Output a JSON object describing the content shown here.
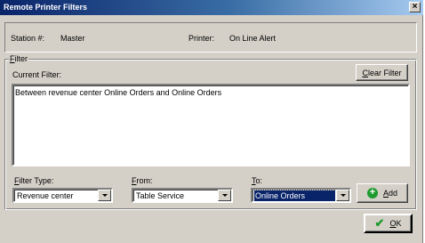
{
  "window": {
    "title": "Remote Printer Filters",
    "close_glyph": "×"
  },
  "info": {
    "station_label": "Station #:",
    "station_value": "Master",
    "printer_label": "Printer:",
    "printer_value": "On Line Alert"
  },
  "filter_group": {
    "legend_first": "F",
    "legend_rest": "ilter",
    "current_filter_label": "Current Filter:",
    "current_filter_text": "Between revenue center Online Orders and Online Orders",
    "clear_button": {
      "mnemonic": "C",
      "rest": "lear Filter"
    }
  },
  "fields": {
    "filter_type": {
      "label_mnemonic": "F",
      "label_rest": "ilter Type:",
      "value": "Revenue center"
    },
    "from": {
      "label_mnemonic": "F",
      "label_rest": "rom:",
      "value": "Table Service"
    },
    "to": {
      "label_mnemonic": "T",
      "label_rest": "o:",
      "value": "Online Orders"
    }
  },
  "add_button": {
    "mnemonic": "A",
    "rest": "dd",
    "icon": "plus-circle-icon"
  },
  "ok_button": {
    "mnemonic": "O",
    "rest": "K",
    "icon": "checkmark-icon"
  }
}
